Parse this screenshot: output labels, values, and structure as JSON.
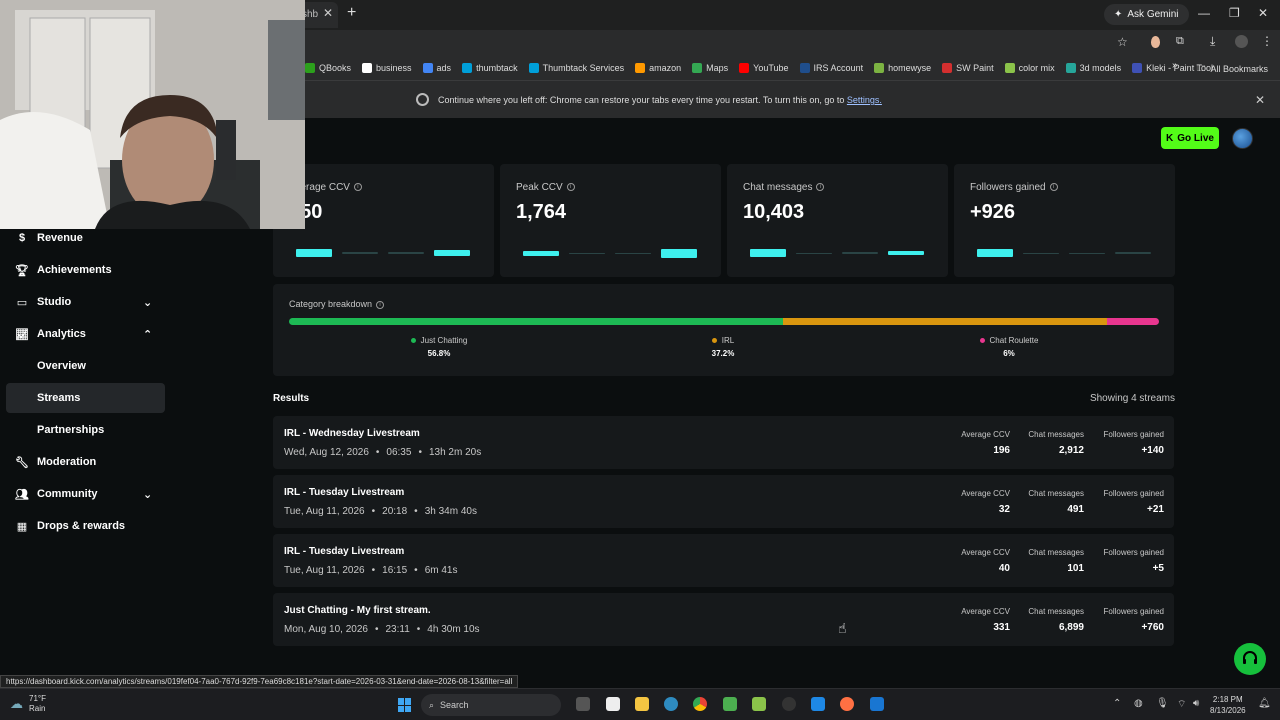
{
  "chrome": {
    "tab_label": "shb",
    "ask_gemini": "Ask Gemini",
    "bookmarks": [
      {
        "label": "QBooks",
        "color": "#2ca01c"
      },
      {
        "label": "business",
        "color": "#ffffff"
      },
      {
        "label": "ads",
        "color": "#4285f4"
      },
      {
        "label": "thumbtack",
        "color": "#009fd9"
      },
      {
        "label": "Thumbtack Services",
        "color": "#009fd9"
      },
      {
        "label": "amazon",
        "color": "#ff9900"
      },
      {
        "label": "Maps",
        "color": "#34a853"
      },
      {
        "label": "YouTube",
        "color": "#ff0000"
      },
      {
        "label": "IRS Account",
        "color": "#1f4e8c"
      },
      {
        "label": "homewyse",
        "color": "#7cb342"
      },
      {
        "label": "SW Paint",
        "color": "#d32f2f"
      },
      {
        "label": "color mix",
        "color": "#8bc34a"
      },
      {
        "label": "3d models",
        "color": "#26a69a"
      },
      {
        "label": "Kleki - Paint Tool",
        "color": "#3f51b5"
      }
    ],
    "all_bookmarks": "All Bookmarks",
    "restore_text": "Continue where you left off: Chrome can restore your tabs every time you restart. To turn this on, go to",
    "restore_link": "Settings."
  },
  "header": {
    "go_live": "Go Live"
  },
  "sidebar": {
    "items": [
      {
        "label": "Revenue",
        "icon": "dollar-icon"
      },
      {
        "label": "Achievements",
        "icon": "trophy-icon"
      },
      {
        "label": "Studio",
        "icon": "studio-icon"
      },
      {
        "label": "Analytics",
        "icon": "analytics-icon"
      },
      {
        "label": "Moderation",
        "icon": "wrench-icon"
      },
      {
        "label": "Community",
        "icon": "community-icon"
      },
      {
        "label": "Drops & rewards",
        "icon": "drops-icon"
      }
    ],
    "analytics_sub": [
      {
        "label": "Overview"
      },
      {
        "label": "Streams"
      },
      {
        "label": "Partnerships"
      }
    ]
  },
  "stats": [
    {
      "label": "Average CCV",
      "value": "250",
      "bars": [
        0.9,
        0.2,
        0.2,
        0.7
      ]
    },
    {
      "label": "Peak CCV",
      "value": "1,764",
      "bars": [
        0.6,
        0.15,
        0.15,
        1.0
      ]
    },
    {
      "label": "Chat messages",
      "value": "10,403",
      "bars": [
        0.85,
        0.1,
        0.2,
        0.45
      ]
    },
    {
      "label": "Followers gained",
      "value": "+926",
      "bars": [
        0.9,
        0.1,
        0.15,
        0.25
      ]
    }
  ],
  "category": {
    "title": "Category breakdown",
    "items": [
      {
        "name": "Just Chatting",
        "pct": "56.8%",
        "value": 56.8,
        "color": "#1db954"
      },
      {
        "name": "IRL",
        "pct": "37.2%",
        "value": 37.2,
        "color": "#d9960f"
      },
      {
        "name": "Chat Roulette",
        "pct": "6%",
        "value": 6,
        "color": "#e8368f"
      }
    ]
  },
  "results": {
    "title": "Results",
    "count": "Showing 4 streams",
    "col_avg": "Average CCV",
    "col_chat": "Chat messages",
    "col_followers": "Followers gained",
    "rows": [
      {
        "title": "IRL - Wednesday Livestream",
        "date": "Wed, Aug 12, 2026",
        "time": "06:35",
        "duration": "13h 2m 20s",
        "avg": "196",
        "chat": "2,912",
        "followers": "+140"
      },
      {
        "title": "IRL - Tuesday Livestream",
        "date": "Tue, Aug 11, 2026",
        "time": "20:18",
        "duration": "3h 34m 40s",
        "avg": "32",
        "chat": "491",
        "followers": "+21"
      },
      {
        "title": "IRL - Tuesday Livestream",
        "date": "Tue, Aug 11, 2026",
        "time": "16:15",
        "duration": "6m 41s",
        "avg": "40",
        "chat": "101",
        "followers": "+5"
      },
      {
        "title": "Just Chatting - My first stream.",
        "date": "Mon, Aug 10, 2026",
        "time": "23:11",
        "duration": "4h 30m 10s",
        "avg": "331",
        "chat": "6,899",
        "followers": "+760"
      }
    ]
  },
  "status_url": "https://dashboard.kick.com/analytics/streams/019fef04-7aa0-767d-92f9-7ea69c8c181e?start-date=2026-03-31&end-date=2026-08-13&filter=all",
  "taskbar": {
    "temp": "71°F",
    "weather": "Rain",
    "search": "Search",
    "time": "2:18 PM",
    "date": "8/13/2026"
  },
  "colors": {
    "accent": "#53fc18",
    "bar": "#3ef0ee",
    "card": "#16191b"
  }
}
